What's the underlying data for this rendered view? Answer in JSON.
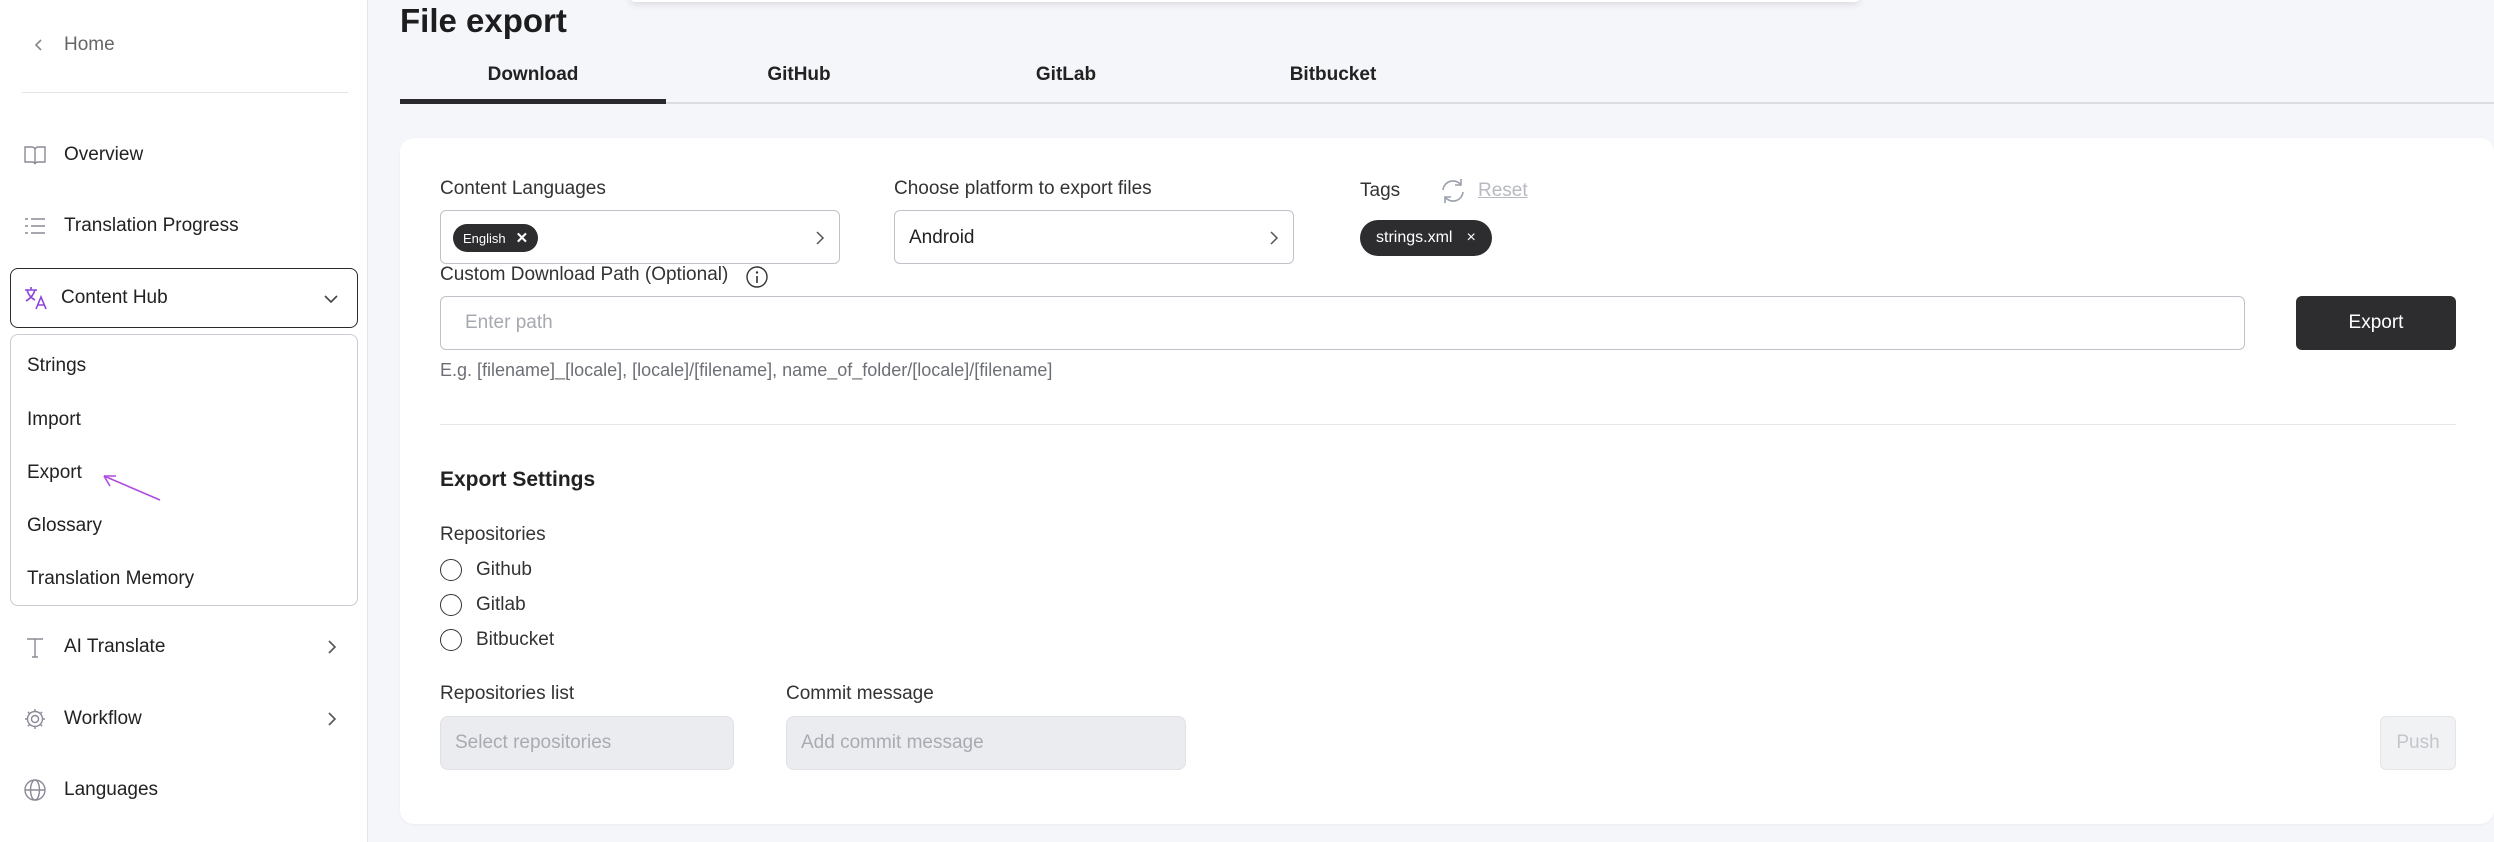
{
  "sidebar": {
    "home_label": "Home",
    "items": [
      {
        "label": "Overview",
        "icon": "book-open-icon"
      },
      {
        "label": "Translation Progress",
        "icon": "list-icon"
      },
      {
        "label": "Content Hub",
        "icon": "translate-icon"
      },
      {
        "label": "AI Translate",
        "icon": "text-t-icon"
      },
      {
        "label": "Workflow",
        "icon": "gear-icon"
      },
      {
        "label": "Languages",
        "icon": "globe-icon"
      }
    ],
    "submenu": [
      "Strings",
      "Import",
      "Export",
      "Glossary",
      "Translation Memory"
    ],
    "accent_color": "#8e44d8"
  },
  "page": {
    "title": "File export",
    "tabs": [
      "Download",
      "GitHub",
      "GitLab",
      "Bitbucket"
    ],
    "active_tab": "Download"
  },
  "form": {
    "content_languages_label": "Content Languages",
    "language_chip": "English",
    "platform_label": "Choose platform to export files",
    "platform_value": "Android",
    "tags_label": "Tags",
    "reset_label": "Reset",
    "tag_chip": "strings.xml",
    "path_label": "Custom Download Path (Optional)",
    "path_placeholder": "Enter path",
    "export_button": "Export",
    "hint": "E.g. [filename]_[locale], [locale]/[filename], name_of_folder/[locale]/[filename]"
  },
  "export_settings": {
    "title": "Export Settings",
    "repositories_label": "Repositories",
    "repositories": [
      "Github",
      "Gitlab",
      "Bitbucket"
    ],
    "repositories_list_label": "Repositories list",
    "repositories_list_placeholder": "Select repositories",
    "commit_message_label": "Commit message",
    "commit_message_placeholder": "Add commit message",
    "push_button": "Push"
  }
}
